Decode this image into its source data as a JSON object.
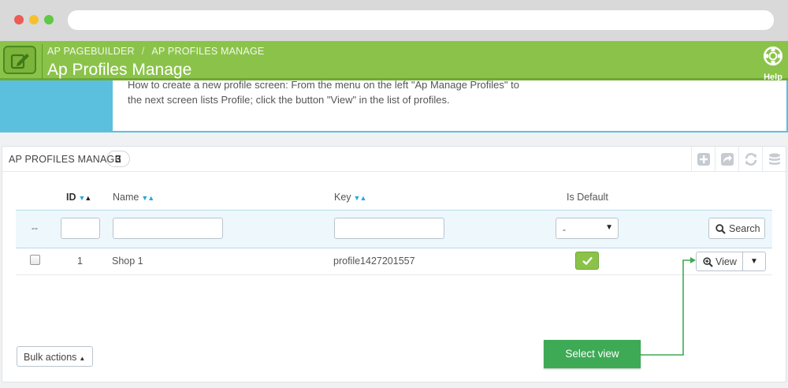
{
  "browser": {
    "url": ""
  },
  "header": {
    "breadcrumb": [
      "AP PAGEBUILDER",
      "AP PROFILES MANAGE"
    ],
    "breadcrumb_separator": "/",
    "title": "Ap Profiles Manage",
    "help_label": "Help",
    "accent_color": "#8bc34a"
  },
  "info": {
    "lines": [
      "How to create a new profile screen: From the menu on the left \"Ap Manage Profiles\" to",
      "the next screen lists Profile; click the button \"View\" in the list of profiles."
    ]
  },
  "panel": {
    "title": "AP PROFILES MANAGE",
    "count": "3",
    "toolbar_icons": [
      "add-icon",
      "export-icon",
      "refresh-icon",
      "database-icon"
    ]
  },
  "table": {
    "columns": {
      "id": "ID",
      "name": "Name",
      "key": "Key",
      "is_default": "Is Default"
    },
    "filter": {
      "placeholder_dash": "--",
      "is_default_value": "-",
      "search_label": "Search"
    },
    "rows": [
      {
        "id": "1",
        "name": "Shop 1",
        "key": "profile1427201557",
        "is_default": true,
        "action_label": "View"
      }
    ]
  },
  "bulk_actions_label": "Bulk actions",
  "annotation": {
    "text": "Select view",
    "color": "#3eaa55"
  }
}
